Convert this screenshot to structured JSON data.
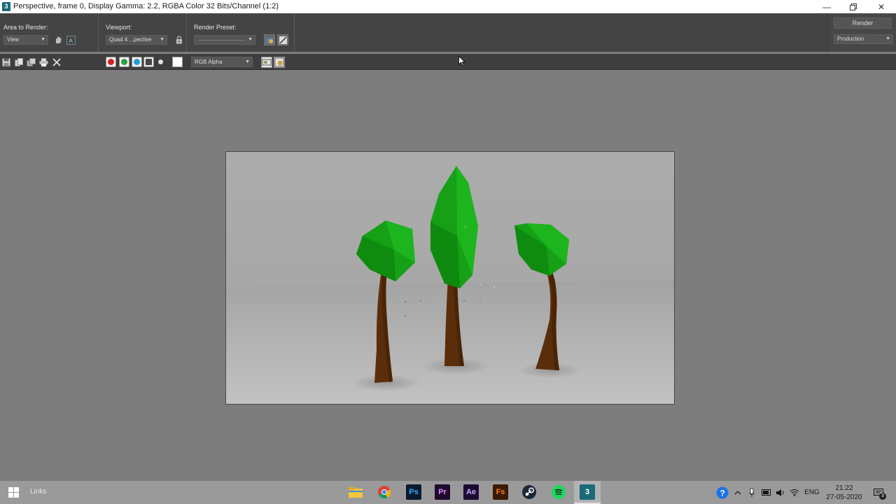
{
  "window": {
    "title": "Perspective, frame 0, Display Gamma: 2.2, RGBA Color 32 Bits/Channel (1:2)",
    "app_icon_label": "3",
    "controls": [
      "minimize-icon",
      "restore-icon",
      "close-icon"
    ]
  },
  "toolbar": {
    "area_to_render": {
      "label": "Area to Render:",
      "value": "View"
    },
    "viewport": {
      "label": "Viewport:",
      "value": "Quad 4 ...pective"
    },
    "render_preset": {
      "label": "Render Preset:",
      "value": ""
    },
    "render_button": "Render",
    "production": {
      "value": "Production"
    }
  },
  "toolbar2": {
    "channel_display": "RGB Alpha",
    "channels": [
      {
        "name": "red",
        "color": "#d42020"
      },
      {
        "name": "green",
        "color": "#2ea043"
      },
      {
        "name": "blue",
        "color": "#1ea0d8"
      }
    ]
  },
  "taskbar": {
    "search_label": "Links",
    "apps": [
      "file-explorer-icon",
      "chrome-icon",
      "photoshop-icon",
      "premiere-icon",
      "after-effects-icon",
      "fs-icon",
      "steam-icon",
      "spotify-icon",
      "3dsmax-icon"
    ],
    "app_labels": {
      "ps": "Ps",
      "pr": "Pr",
      "ae": "Ae",
      "fs": "Fs",
      "max": "3"
    },
    "language": "ENG",
    "time": "21:22",
    "date": "27-05-2020",
    "notification_count": "3"
  },
  "colors": {
    "tree_green": "#15a215",
    "trunk_brown": "#5a2e0a",
    "ui_dark": "#444444"
  }
}
